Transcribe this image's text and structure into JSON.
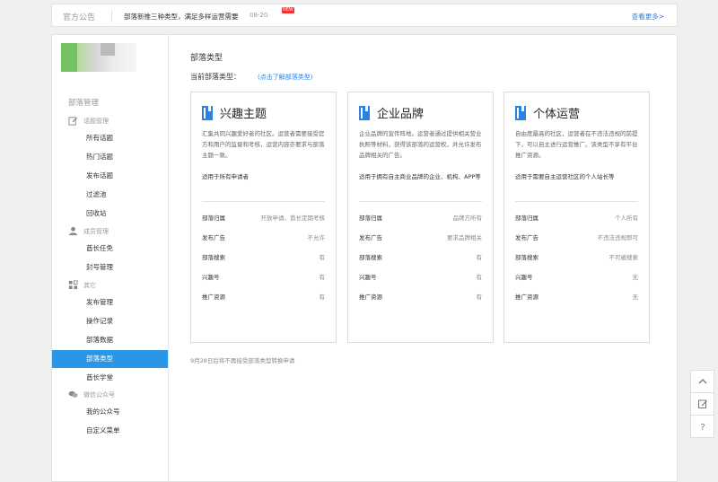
{
  "announcement": {
    "title": "官方公告",
    "text": "部落新推三种类型，满足多样运营需要",
    "date": "08-20",
    "badge": "NEW",
    "more": "查看更多>"
  },
  "sidebar": {
    "heading": "部落管理",
    "groups": [
      {
        "label": "话题管理",
        "icon": "edit-icon"
      },
      {
        "label": "成员管理",
        "icon": "user-icon"
      },
      {
        "label": "其它",
        "icon": "grid-icon"
      },
      {
        "label": "微信公众号",
        "icon": "wechat-icon"
      }
    ],
    "items": [
      {
        "label": "所有话题"
      },
      {
        "label": "热门话题"
      },
      {
        "label": "发布话题"
      },
      {
        "label": "过滤池"
      },
      {
        "label": "回收站"
      },
      {
        "label": "酋长任免"
      },
      {
        "label": "封号管理"
      },
      {
        "label": "发布管理"
      },
      {
        "label": "操作记录"
      },
      {
        "label": "部落数据"
      },
      {
        "label": "部落类型",
        "active": true
      },
      {
        "label": "酋长学堂"
      },
      {
        "label": "我的公众号"
      },
      {
        "label": "自定义菜单"
      }
    ]
  },
  "main": {
    "title": "部落类型",
    "current_label": "当前部落类型：",
    "learn_link": "(点击了解部落类型)",
    "footnote": "9月28日后将不再接受部落类型转换申请",
    "cards": [
      {
        "title": "兴趣主题",
        "desc": "汇集共同兴趣爱好者的社区。运营者需要接受官方和用户的监督和考核，运营内容亦要求与部落主题一致。",
        "applies": "适用于所有申请者",
        "rows": [
          {
            "key": "部落归属",
            "value": "开放申请，酋长定期考核"
          },
          {
            "key": "发布广告",
            "value": "不允许"
          },
          {
            "key": "部落搜索",
            "value": "有"
          },
          {
            "key": "兴趣号",
            "value": "有"
          },
          {
            "key": "推广资源",
            "value": "有"
          }
        ]
      },
      {
        "title": "企业品牌",
        "desc": "企业品牌的宣传阵地。运营者通过提供相关营业执照等材料，获得该部落的运营权，并允许发布品牌相关的广告。",
        "applies": "适用于拥有自主商业品牌的企业、机构、APP等",
        "rows": [
          {
            "key": "部落归属",
            "value": "品牌方所有"
          },
          {
            "key": "发布广告",
            "value": "要求品牌相关"
          },
          {
            "key": "部落搜索",
            "value": "有"
          },
          {
            "key": "兴趣号",
            "value": "有"
          },
          {
            "key": "推广资源",
            "value": "有"
          }
        ]
      },
      {
        "title": "个体运营",
        "desc": "自由度最高的社区，运营者在不违法违规的前提下，可以自主进行运营推广。该类型不享有平台推广资源。",
        "applies": "适用于需要自主运营社区的个人站长等",
        "rows": [
          {
            "key": "部落归属",
            "value": "个人所有"
          },
          {
            "key": "发布广告",
            "value": "不违法违规即可"
          },
          {
            "key": "部落搜索",
            "value": "不可被搜索"
          },
          {
            "key": "兴趣号",
            "value": "无"
          },
          {
            "key": "推广资源",
            "value": "无"
          }
        ]
      }
    ]
  },
  "float_buttons": [
    {
      "icon": "chevron-up-icon",
      "label": "^"
    },
    {
      "icon": "feedback-icon",
      "label": "✎"
    },
    {
      "icon": "help-icon",
      "label": "?"
    }
  ],
  "colors": {
    "accent": "#2a96e6",
    "link": "#2a82e4",
    "new_badge": "#ee3333"
  }
}
